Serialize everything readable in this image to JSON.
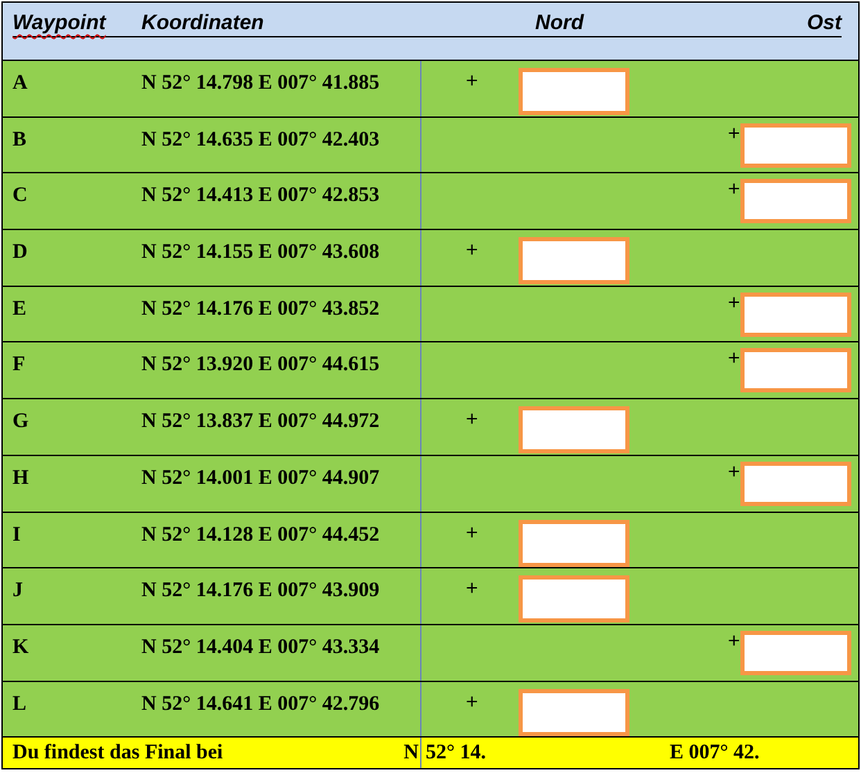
{
  "header": {
    "columns": [
      "Waypoint",
      "Koordinaten",
      "Nord",
      "Ost"
    ]
  },
  "rows": [
    {
      "waypoint": "A",
      "coordinates": "N 52° 14.798 E 007° 41.885",
      "kind": "nord",
      "sign": "+"
    },
    {
      "waypoint": "B",
      "coordinates": "N 52° 14.635 E 007° 42.403",
      "kind": "ost",
      "sign": "+"
    },
    {
      "waypoint": "C",
      "coordinates": "N 52° 14.413 E 007° 42.853",
      "kind": "ost",
      "sign": "+"
    },
    {
      "waypoint": "D",
      "coordinates": "N 52° 14.155 E 007° 43.608",
      "kind": "nord",
      "sign": "+"
    },
    {
      "waypoint": "E",
      "coordinates": "N 52° 14.176 E 007° 43.852",
      "kind": "ost",
      "sign": "+"
    },
    {
      "waypoint": "F",
      "coordinates": "N 52° 13.920 E 007° 44.615",
      "kind": "ost",
      "sign": "+"
    },
    {
      "waypoint": "G",
      "coordinates": "N 52° 13.837 E 007° 44.972",
      "kind": "nord",
      "sign": "+"
    },
    {
      "waypoint": "H",
      "coordinates": "N 52° 14.001 E 007° 44.907",
      "kind": "ost",
      "sign": "+"
    },
    {
      "waypoint": "I",
      "coordinates": "N 52° 14.128 E 007° 44.452",
      "kind": "nord",
      "sign": "+"
    },
    {
      "waypoint": "J",
      "coordinates": "N 52° 14.176 E 007° 43.909",
      "kind": "nord",
      "sign": "+"
    },
    {
      "waypoint": "K",
      "coordinates": "N 52° 14.404 E 007° 43.334",
      "kind": "ost",
      "sign": "+"
    },
    {
      "waypoint": "L",
      "coordinates": "N 52° 14.641 E 007° 42.796",
      "kind": "nord",
      "sign": "+"
    }
  ],
  "footer": {
    "label": "Du findest das Final bei",
    "north_prefix": "N",
    "north": "52° 14.",
    "east": "E 007° 42."
  }
}
